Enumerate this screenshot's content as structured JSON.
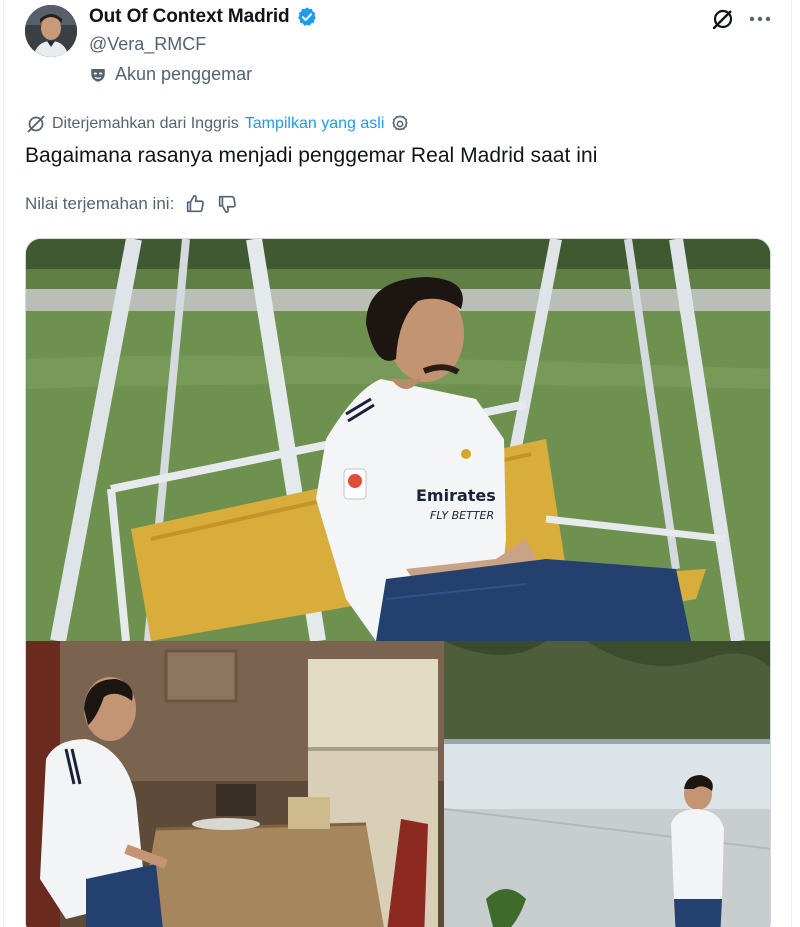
{
  "author": {
    "display_name": "Out Of Context Madrid",
    "handle": "@Vera_RMCF",
    "account_label": "Akun penggemar",
    "verified": true,
    "accent_color": "#1d9bf0"
  },
  "translation": {
    "translated_from": "Diterjemahkan dari Inggris",
    "show_original": "Tampilkan yang asli"
  },
  "tweet": {
    "text": "Bagaimana rasanya menjadi penggemar Real Madrid saat ini"
  },
  "rating": {
    "label": "Nilai terjemahan ini:"
  },
  "media": {
    "panels": [
      {
        "position": "top",
        "description": ""
      },
      {
        "position": "bottom-left",
        "description": ""
      },
      {
        "position": "bottom-right",
        "description": ""
      }
    ],
    "shirt_text_line1": "Emirates",
    "shirt_text_line2": "FLY BETTER"
  },
  "icons": {
    "verified": "verified-badge-icon",
    "account_type": "mask-icon",
    "grok": "grok-icon",
    "more": "more-icon",
    "translate": "translate-icon",
    "settings": "gear-icon",
    "like_translation": "thumbs-up-icon",
    "dislike_translation": "thumbs-down-icon"
  }
}
